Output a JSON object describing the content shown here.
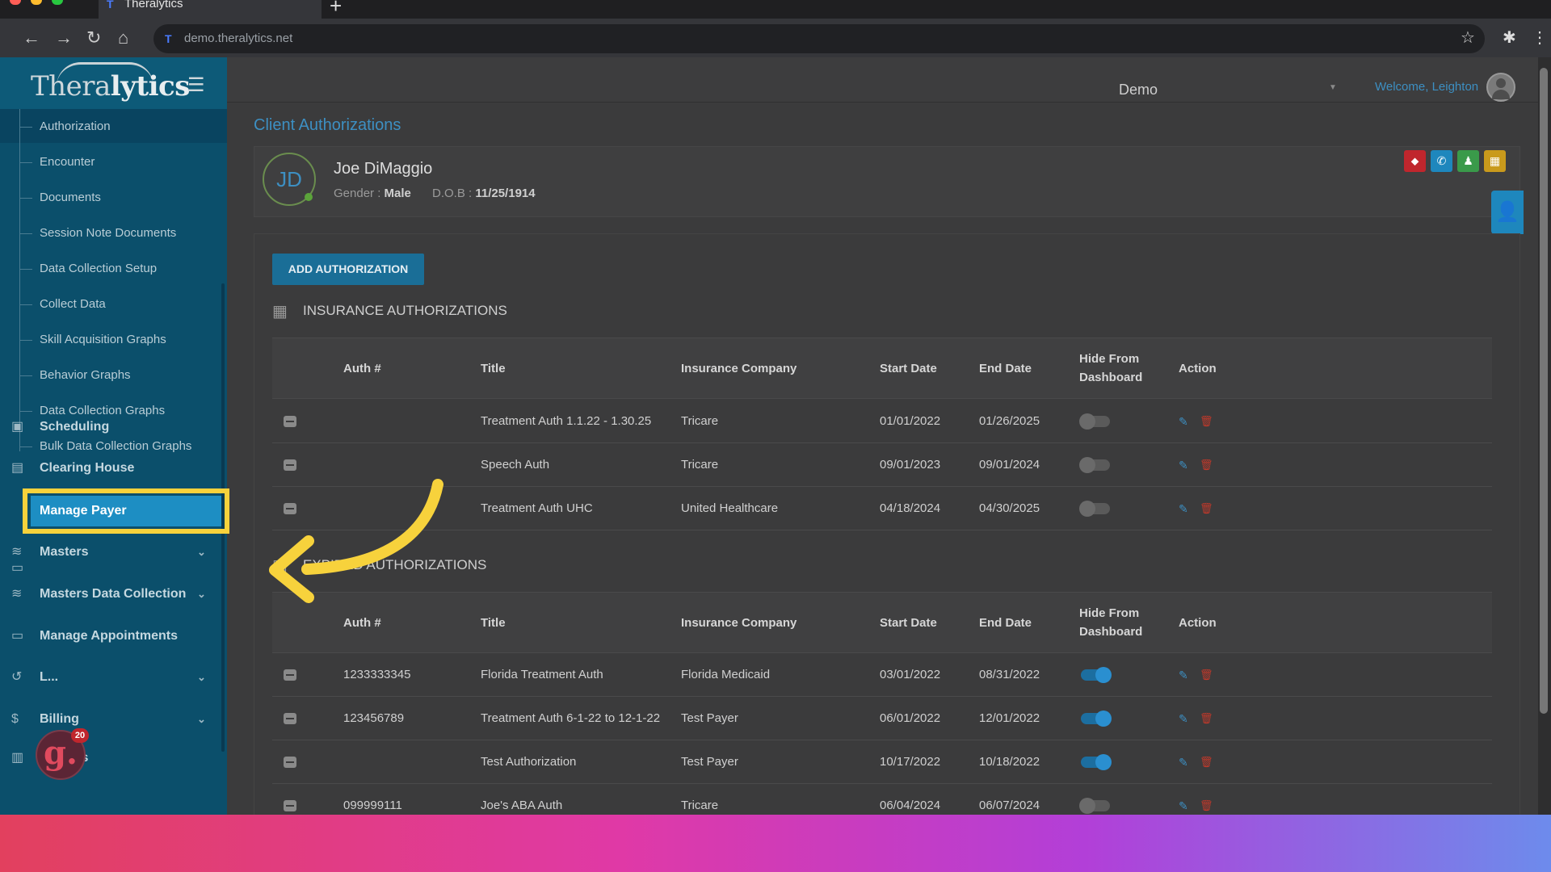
{
  "browser": {
    "tab_title": "Theralytics",
    "tab_icon": "T",
    "new_tab": "+",
    "url": "demo.theralytics.net"
  },
  "app": {
    "logo_plain": "Thera",
    "logo_bold": "lytics",
    "org_select": "Demo",
    "welcome": "Welcome, Leighton",
    "page_title": "Client Authorizations"
  },
  "sidebar": {
    "subitems": [
      "Authorization",
      "Encounter",
      "Documents",
      "Session Note Documents",
      "Data Collection Setup",
      "Collect Data",
      "Skill Acquisition Graphs",
      "Behavior Graphs",
      "Data Collection Graphs",
      "Bulk Data Collection Graphs"
    ],
    "main": [
      {
        "label": "Scheduling",
        "icon": "calendar-icon"
      },
      {
        "label": "Clearing House",
        "icon": "id-card-icon"
      },
      {
        "label": "Manage Payer",
        "icon": "card-icon"
      },
      {
        "label": "Masters",
        "icon": "database-icon"
      },
      {
        "label": "Masters Data Collection",
        "icon": "database-icon"
      },
      {
        "label": "Manage Appointments",
        "icon": "card-icon"
      },
      {
        "label": "L...",
        "icon": "history-icon"
      },
      {
        "label": "Billing",
        "icon": "dollar-icon"
      },
      {
        "label": "Reports",
        "icon": "clipboard-icon"
      }
    ]
  },
  "client": {
    "initials": "JD",
    "name": "Joe DiMaggio",
    "gender_label": "Gender : ",
    "gender": "Male",
    "dob_label": "D.O.B : ",
    "dob": "11/25/1914"
  },
  "add_button": "ADD AUTHORIZATION",
  "columns": [
    "Auth #",
    "Title",
    "Insurance Company",
    "Start Date",
    "End Date",
    "Hide From",
    "Dashboard",
    "Action"
  ],
  "insurance": {
    "heading": "INSURANCE AUTHORIZATIONS",
    "rows": [
      {
        "auth": "",
        "title": "Treatment Auth 1.1.22 - 1.30.25",
        "company": "Tricare",
        "start": "01/01/2022",
        "end": "01/26/2025",
        "hide": false
      },
      {
        "auth": "",
        "title": "Speech Auth",
        "company": "Tricare",
        "start": "09/01/2023",
        "end": "09/01/2024",
        "hide": false
      },
      {
        "auth": "",
        "title": "Treatment Auth UHC",
        "company": "United Healthcare",
        "start": "04/18/2024",
        "end": "04/30/2025",
        "hide": false
      }
    ]
  },
  "expired": {
    "heading": "EXPIRED AUTHORIZATIONS",
    "rows": [
      {
        "auth": "1233333345",
        "title": "Florida Treatment Auth",
        "company": "Florida Medicaid",
        "start": "03/01/2022",
        "end": "08/31/2022",
        "hide": true
      },
      {
        "auth": "123456789",
        "title": "Treatment Auth 6-1-22 to 12-1-22",
        "company": "Test Payer",
        "start": "06/01/2022",
        "end": "12/01/2022",
        "hide": true
      },
      {
        "auth": "",
        "title": "Test Authorization",
        "company": "Test Payer",
        "start": "10/17/2022",
        "end": "10/18/2022",
        "hide": true
      },
      {
        "auth": "099999111",
        "title": "Joe's ABA Auth",
        "company": "Tricare",
        "start": "06/04/2024",
        "end": "06/07/2024",
        "hide": false
      }
    ]
  },
  "quick_actions": [
    {
      "icon": "tag-icon",
      "color": "#c0262d"
    },
    {
      "icon": "phone-icon",
      "color": "#1e87bd"
    },
    {
      "icon": "contact-icon",
      "color": "#3a9a4a"
    },
    {
      "icon": "calendar-icon",
      "color": "#c99a1c"
    }
  ],
  "badge": {
    "letter": "g.",
    "count": "20"
  }
}
